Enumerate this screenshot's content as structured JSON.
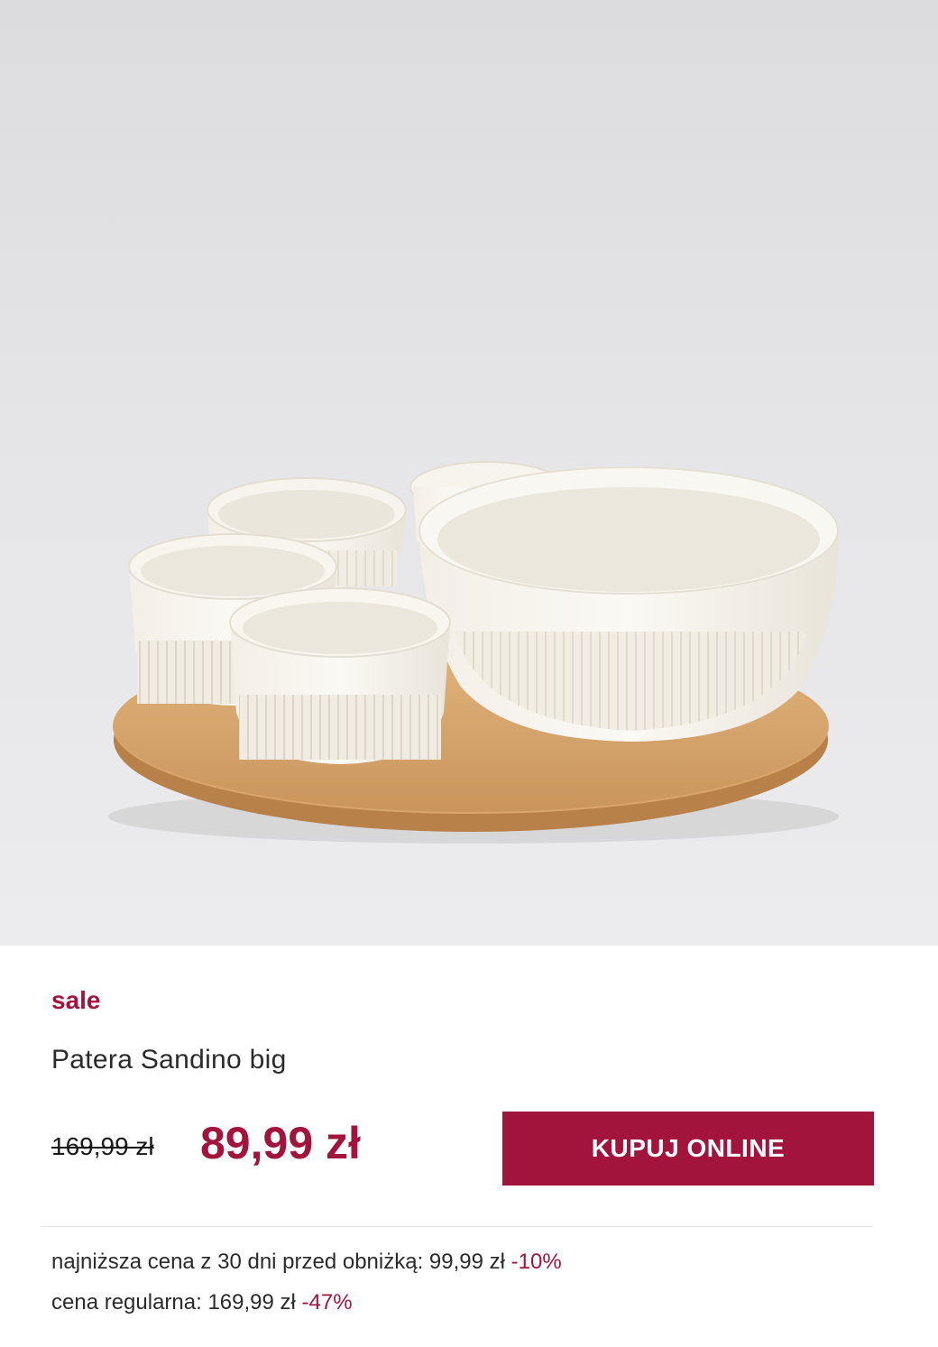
{
  "product": {
    "image_alt": "Patera Sandino big",
    "badge": "sale",
    "name": "Patera Sandino big",
    "old_price": "169,99 zł",
    "new_price": "89,99 zł",
    "buy_label": "KUPUJ ONLINE",
    "lowest_price_label": "najniższa cena z 30 dni przed obniżką: 99,99 zł",
    "lowest_price_discount": "-10%",
    "regular_price_label": "cena regularna: 169,99 zł",
    "regular_price_discount": "-47%"
  },
  "colors": {
    "accent": "#a3143c",
    "text": "#2b2b2b",
    "background": "#ffffff",
    "image_background": "#e5e5e7"
  }
}
